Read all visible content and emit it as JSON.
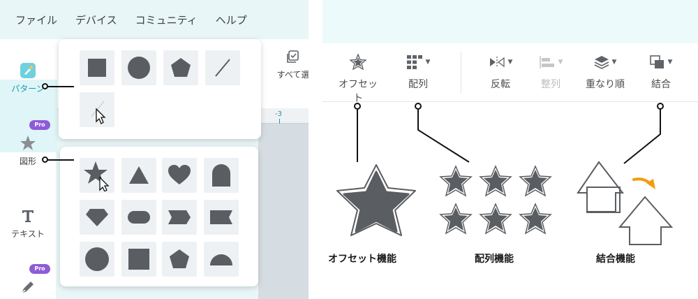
{
  "menubar": {
    "items": [
      "ファイル",
      "デバイス",
      "コミュニティ",
      "ヘルプ"
    ]
  },
  "sidebar": {
    "items": [
      {
        "label": "パターン",
        "icon": "brush-icon",
        "active": true
      },
      {
        "label": "図形",
        "icon": "star-icon",
        "badge": "Pro"
      },
      {
        "label": "テキスト",
        "icon": "text-icon"
      },
      {
        "label": "",
        "icon": "pen-icon",
        "badge": "Pro"
      }
    ]
  },
  "canvas": {
    "select_all_label": "すべて選",
    "ruler_label": "-3"
  },
  "toolbar": {
    "buttons": [
      {
        "label": "オフセット",
        "icon": "offset-star-icon",
        "enabled": true,
        "dropdown": false
      },
      {
        "label": "配列",
        "icon": "array-grid-icon",
        "enabled": true,
        "dropdown": true
      },
      {
        "label": "反転",
        "icon": "flip-icon",
        "enabled": true,
        "dropdown": true
      },
      {
        "label": "整列",
        "icon": "align-icon",
        "enabled": false,
        "dropdown": true
      },
      {
        "label": "重なり順",
        "icon": "layers-icon",
        "enabled": true,
        "dropdown": true
      },
      {
        "label": "結合",
        "icon": "combine-icon",
        "enabled": true,
        "dropdown": true
      }
    ]
  },
  "features": {
    "offset_label": "オフセット機能",
    "array_label": "配列機能",
    "combine_label": "結合機能"
  },
  "colors": {
    "shape_fill": "#5a5d61",
    "accent_orange": "#f39c12",
    "pro_badge": "#8e5bd8",
    "teal_bg": "#e9f6f8"
  }
}
